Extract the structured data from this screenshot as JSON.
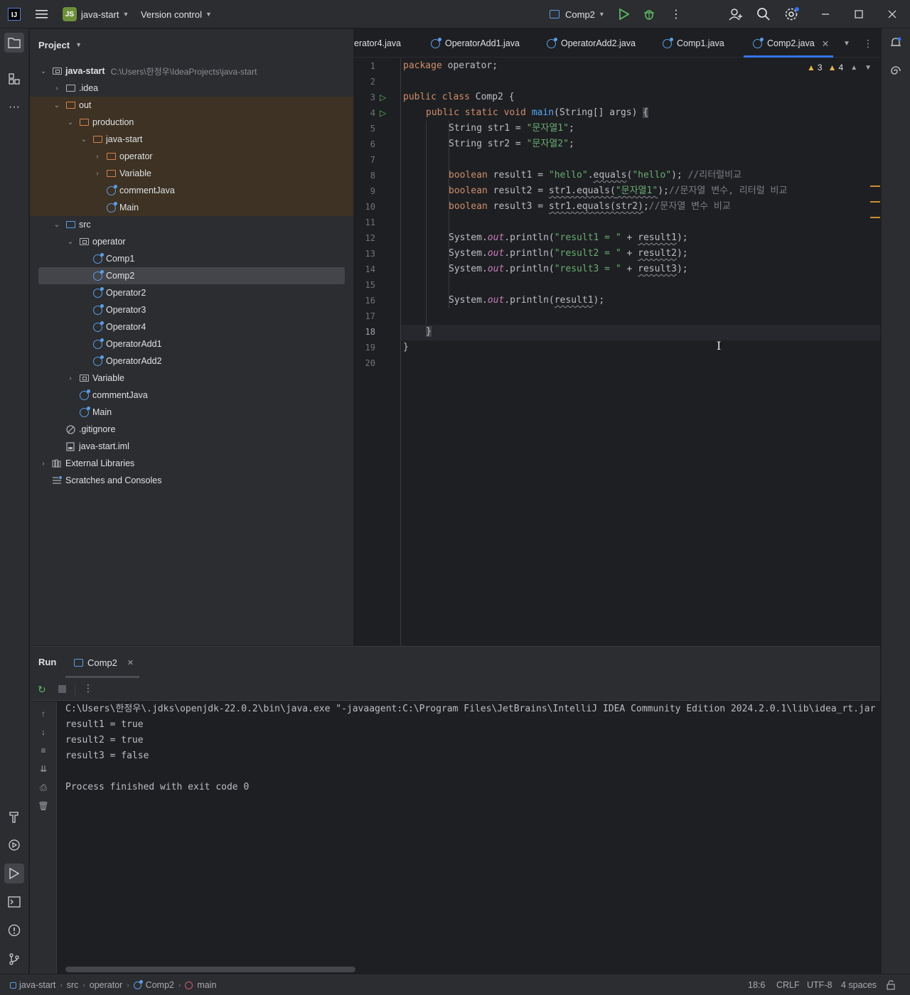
{
  "titlebar": {
    "logo": "IJ",
    "project_badge": "JS",
    "project_name": "java-start",
    "vcs": "Version control",
    "run_config": "Comp2"
  },
  "project_panel": {
    "title": "Project",
    "root_label": "java-start",
    "root_path": "C:\\Users\\한정우\\IdeaProjects\\java-start",
    "items": [
      {
        "label": ".idea"
      },
      {
        "label": "out"
      },
      {
        "label": "production"
      },
      {
        "label": "java-start"
      },
      {
        "label": "operator"
      },
      {
        "label": "Variable"
      },
      {
        "label": "commentJava"
      },
      {
        "label": "Main"
      },
      {
        "label": "src"
      },
      {
        "label": "operator"
      },
      {
        "label": "Comp1"
      },
      {
        "label": "Comp2"
      },
      {
        "label": "Operator2"
      },
      {
        "label": "Operator3"
      },
      {
        "label": "Operator4"
      },
      {
        "label": "OperatorAdd1"
      },
      {
        "label": "OperatorAdd2"
      },
      {
        "label": "Variable"
      },
      {
        "label": "commentJava"
      },
      {
        "label": "Main"
      },
      {
        "label": ".gitignore"
      },
      {
        "label": "java-start.iml"
      },
      {
        "label": "External Libraries"
      },
      {
        "label": "Scratches and Consoles"
      }
    ]
  },
  "editor": {
    "tabs": [
      {
        "label": "erator4.java"
      },
      {
        "label": "OperatorAdd1.java"
      },
      {
        "label": "OperatorAdd2.java"
      },
      {
        "label": "Comp1.java"
      },
      {
        "label": "Comp2.java"
      }
    ],
    "warnings": "3",
    "weak_warnings": "4",
    "line_numbers": [
      "1",
      "2",
      "3",
      "4",
      "5",
      "6",
      "7",
      "8",
      "9",
      "10",
      "11",
      "12",
      "13",
      "14",
      "15",
      "16",
      "17",
      "18",
      "19",
      "20"
    ],
    "code": {
      "l1_kw": "package",
      "l1_rest": " operator;",
      "l3_kw": "public class",
      "l3_rest": " Comp2 {",
      "l4_kw": "public static void",
      "l4_fn": "main",
      "l4_rest": "(String[] args) ",
      "l4_brace": "{",
      "l5_pre": "String str1 = ",
      "l5_str": "\"문자열1\"",
      "l5_end": ";",
      "l6_pre": "String str2 = ",
      "l6_str": "\"문자열2\"",
      "l6_end": ";",
      "l8_kw": "boolean",
      "l8_a": " result1 = ",
      "l8_s1": "\"hello\"",
      "l8_b": ".",
      "l8_eq": "equals",
      "l8_c": "(",
      "l8_s2": "\"hello\"",
      "l8_d": "); ",
      "l8_cmt": "//리터럴비교",
      "l9_kw": "boolean",
      "l9_a": " result2 = ",
      "l9_w": "str1.equals(",
      "l9_s": "\"문자열1\"",
      "l9_d": ");",
      "l9_cmt": "//문자열 변수, 리터럴 비교",
      "l10_kw": "boolean",
      "l10_a": " result3 = ",
      "l10_w": "str1.equals(str2)",
      "l10_d": ";",
      "l10_cmt": "//문자열 변수 비교",
      "l12_a": "System.",
      "l12_out": "out",
      "l12_b": ".println(",
      "l12_s": "\"result1 = \"",
      "l12_c": " + ",
      "l12_v": "result1",
      "l12_d": ");",
      "l13_a": "System.",
      "l13_out": "out",
      "l13_b": ".println(",
      "l13_s": "\"result2 = \"",
      "l13_c": " + ",
      "l13_v": "result2",
      "l13_d": ");",
      "l14_a": "System.",
      "l14_out": "out",
      "l14_b": ".println(",
      "l14_s": "\"result3 = \"",
      "l14_c": " + ",
      "l14_v": "result3",
      "l14_d": ");",
      "l16_a": "System.",
      "l16_out": "out",
      "l16_b": ".println(",
      "l16_v": "result1",
      "l16_d": ");",
      "l18": "}",
      "l19": "}"
    }
  },
  "run_panel": {
    "title": "Run",
    "tab_label": "Comp2",
    "output": [
      "C:\\Users\\한정우\\.jdks\\openjdk-22.0.2\\bin\\java.exe \"-javaagent:C:\\Program Files\\JetBrains\\IntelliJ IDEA Community Edition 2024.2.0.1\\lib\\idea_rt.jar",
      "result1 = true",
      "result2 = true",
      "result3 = false",
      "",
      "Process finished with exit code 0"
    ]
  },
  "statusbar": {
    "crumbs": [
      "java-start",
      "src",
      "operator",
      "Comp2",
      "main"
    ],
    "position": "18:6",
    "line_sep": "CRLF",
    "encoding": "UTF-8",
    "indent": "4 spaces"
  },
  "colors": {
    "accent": "#3574f0",
    "keyword": "#cf8e6d",
    "string": "#6aab73",
    "function": "#56a8f5",
    "comment": "#7a7e85",
    "run_green": "#5fb865",
    "excluded_folder": "#d6824b"
  }
}
